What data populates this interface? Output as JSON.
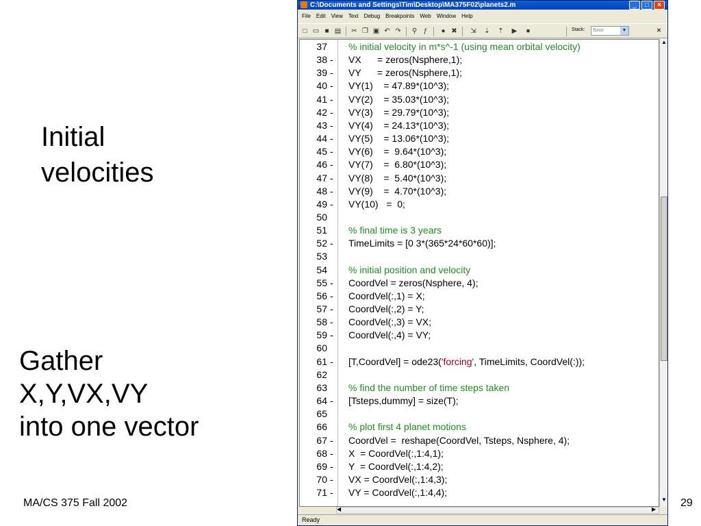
{
  "slide": {
    "heading1": [
      "Initial",
      "velocities"
    ],
    "heading2": [
      "Gather",
      "X,Y,VX,VY",
      "into one vector"
    ],
    "footer_left": "MA/CS 375 Fall 2002",
    "page_number": "29"
  },
  "window": {
    "title": "C:\\Documents and Settings\\Tim\\Desktop\\MA375F02\\planets2.m",
    "menu": [
      "File",
      "Edit",
      "View",
      "Text",
      "Debug",
      "Breakpoints",
      "Web",
      "Window",
      "Help"
    ],
    "stack_label": "Stack:",
    "stack_value": "Base",
    "status": "Ready",
    "colors": {
      "titlebar": "#0842b0",
      "comment": "#228b22",
      "string": "#a0001a"
    }
  },
  "code_lines": [
    {
      "n": "37",
      "dash": "",
      "text": "% initial velocity in m*s^-1 (using mean orbital velocity)",
      "type": "comment"
    },
    {
      "n": "38",
      "dash": "-",
      "text": "VX      = zeros(Nsphere,1);",
      "type": "code"
    },
    {
      "n": "39",
      "dash": "-",
      "text": "VY      = zeros(Nsphere,1);",
      "type": "code"
    },
    {
      "n": "40",
      "dash": "-",
      "text": "VY(1)    = 47.89*(10^3);",
      "type": "code"
    },
    {
      "n": "41",
      "dash": "-",
      "text": "VY(2)    = 35.03*(10^3);",
      "type": "code"
    },
    {
      "n": "42",
      "dash": "-",
      "text": "VY(3)    = 29.79*(10^3);",
      "type": "code"
    },
    {
      "n": "43",
      "dash": "-",
      "text": "VY(4)    = 24.13*(10^3);",
      "type": "code"
    },
    {
      "n": "44",
      "dash": "-",
      "text": "VY(5)    = 13.06*(10^3);",
      "type": "code"
    },
    {
      "n": "45",
      "dash": "-",
      "text": "VY(6)    =  9.64*(10^3);",
      "type": "code"
    },
    {
      "n": "46",
      "dash": "-",
      "text": "VY(7)    =  6.80*(10^3);",
      "type": "code"
    },
    {
      "n": "47",
      "dash": "-",
      "text": "VY(8)    =  5.40*(10^3);",
      "type": "code"
    },
    {
      "n": "48",
      "dash": "-",
      "text": "VY(9)    =  4.70*(10^3);",
      "type": "code"
    },
    {
      "n": "49",
      "dash": "-",
      "text": "VY(10)   =  0;",
      "type": "code"
    },
    {
      "n": "50",
      "dash": "",
      "text": "",
      "type": "code"
    },
    {
      "n": "51",
      "dash": "",
      "text": "% final time is 3 years",
      "type": "comment"
    },
    {
      "n": "52",
      "dash": "-",
      "text": "TimeLimits = [0 3*(365*24*60*60)];",
      "type": "code"
    },
    {
      "n": "53",
      "dash": "",
      "text": "",
      "type": "code"
    },
    {
      "n": "54",
      "dash": "",
      "text": "% initial position and velocity",
      "type": "comment"
    },
    {
      "n": "55",
      "dash": "-",
      "text": "CoordVel = zeros(Nsphere, 4);",
      "type": "code"
    },
    {
      "n": "56",
      "dash": "-",
      "text": "CoordVel(:,1) = X;",
      "type": "code"
    },
    {
      "n": "57",
      "dash": "-",
      "text": "CoordVel(:,2) = Y;",
      "type": "code"
    },
    {
      "n": "58",
      "dash": "-",
      "text": "CoordVel(:,3) = VX;",
      "type": "code"
    },
    {
      "n": "59",
      "dash": "-",
      "text": "CoordVel(:,4) = VY;",
      "type": "code"
    },
    {
      "n": "60",
      "dash": "",
      "text": "",
      "type": "code"
    },
    {
      "n": "61",
      "dash": "-",
      "text": "",
      "type": "ode",
      "pre": "[T,CoordVel] = ode23(",
      "str": "'forcing'",
      "post": ", TimeLimits, CoordVel(:));"
    },
    {
      "n": "62",
      "dash": "",
      "text": "",
      "type": "code"
    },
    {
      "n": "63",
      "dash": "",
      "text": "% find the number of time steps taken",
      "type": "comment"
    },
    {
      "n": "64",
      "dash": "-",
      "text": "[Tsteps,dummy] = size(T);",
      "type": "code"
    },
    {
      "n": "65",
      "dash": "",
      "text": "",
      "type": "code"
    },
    {
      "n": "66",
      "dash": "",
      "text": "% plot first 4 planet motions",
      "type": "comment"
    },
    {
      "n": "67",
      "dash": "-",
      "text": "CoordVel =  reshape(CoordVel, Tsteps, Nsphere, 4);",
      "type": "code"
    },
    {
      "n": "68",
      "dash": "-",
      "text": "X  = CoordVel(:,1:4,1);",
      "type": "code"
    },
    {
      "n": "69",
      "dash": "-",
      "text": "Y  = CoordVel(:,1:4,2);",
      "type": "code"
    },
    {
      "n": "70",
      "dash": "-",
      "text": "VX = CoordVel(:,1:4,3);",
      "type": "code"
    },
    {
      "n": "71",
      "dash": "-",
      "text": "VY = CoordVel(:,1:4,4);",
      "type": "code"
    }
  ]
}
